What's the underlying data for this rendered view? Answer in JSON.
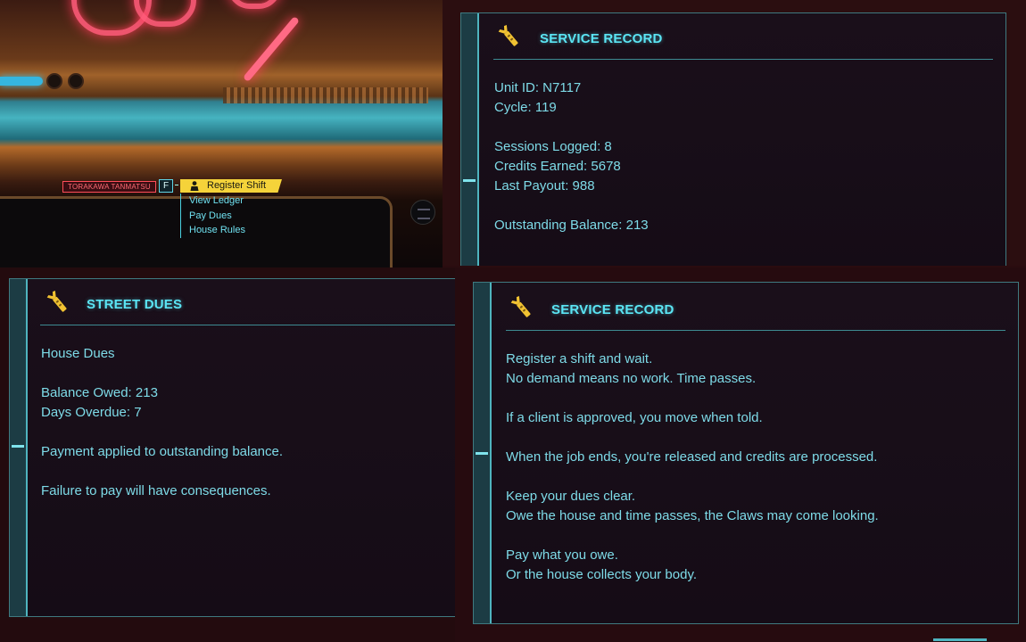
{
  "dialogue": {
    "npc_name": "TORAKAWA TANMATSU",
    "key_hint": "F",
    "selected_option": "Register Shift",
    "options": [
      "View Ledger",
      "Pay Dues",
      "House Rules"
    ]
  },
  "panel_service_record_1": {
    "icon": "wrench-claw-icon",
    "title": "SERVICE RECORD",
    "lines": [
      "Unit ID: N7117",
      "Cycle: 119",
      "",
      "Sessions Logged: 8",
      "Credits Earned: 5678",
      "Last Payout: 988",
      "",
      "Outstanding Balance: 213"
    ]
  },
  "panel_street_dues": {
    "icon": "wrench-claw-icon",
    "title": "STREET DUES",
    "lines": [
      "House Dues",
      "",
      "Balance Owed: 213",
      "Days Overdue: 7",
      "",
      "Payment applied to outstanding balance.",
      "",
      "Failure to pay will have consequences."
    ]
  },
  "panel_service_record_2": {
    "icon": "wrench-claw-icon",
    "title": "SERVICE RECORD",
    "lines": [
      "Register a shift and wait.",
      "No demand means no work. Time passes.",
      "",
      "If a client is approved, you move when told.",
      "",
      "When the job ends, you're released and credits are processed.",
      "",
      "Keep your dues clear.",
      "Owe the house and time passes, the Claws may come looking.",
      "",
      "Pay what you owe.",
      "Or the house collects your body."
    ]
  },
  "colors": {
    "accent_cyan": "#5be5f4",
    "text_cyan": "#7edbe8",
    "selection_yellow": "#f5d33a",
    "npc_red": "#ff4d5a",
    "panel_bg": "#150c16"
  }
}
